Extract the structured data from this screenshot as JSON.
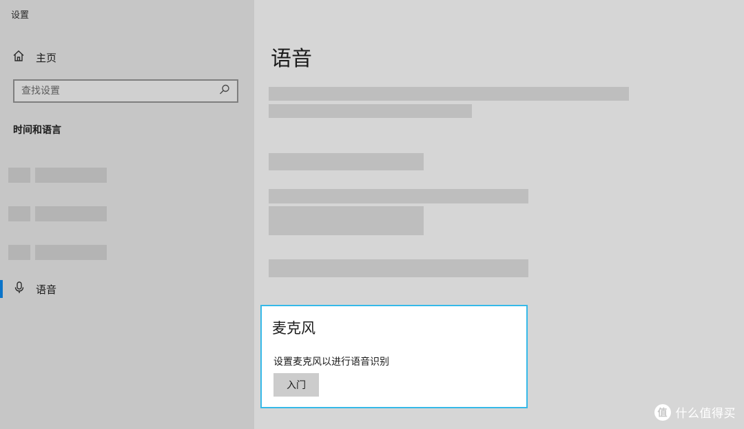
{
  "window": {
    "title": "设置"
  },
  "sidebar": {
    "home_label": "主页",
    "search": {
      "placeholder": "查找设置",
      "value": ""
    },
    "section_heading": "时间和语言",
    "active_item": {
      "label": "语音"
    }
  },
  "main": {
    "page_title": "语音",
    "microphone_card": {
      "title": "麦克风",
      "description": "设置麦克风以进行语音识别",
      "button_label": "入门"
    }
  },
  "watermark": {
    "logo_glyph": "值",
    "text": "什么值得买"
  },
  "icons": {
    "home": "home-icon",
    "search": "search-icon",
    "microphone": "microphone-icon"
  },
  "colors": {
    "accent": "#0b74c9",
    "focus_border": "#35b9e8",
    "sidebar_bg": "#c6c6c6",
    "main_bg": "#d6d6d6",
    "card_bg": "#ffffff",
    "placeholder_bar": "#bebebe"
  }
}
